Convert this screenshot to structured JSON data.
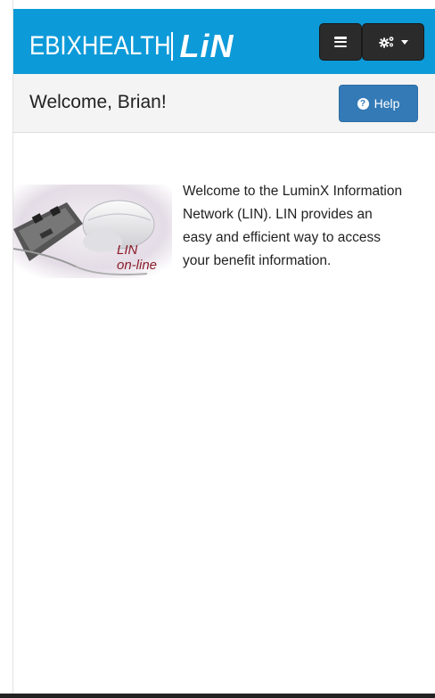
{
  "header": {
    "brand_ebix": "EBIXHEALTH",
    "brand_lin": "LiN",
    "menu_icon": "hamburger-icon",
    "settings_icon": "cogs-icon",
    "colors": {
      "topbar": "#0d9ad8",
      "dark_button": "#2b2b2b"
    }
  },
  "welcome": {
    "title": "Welcome, Brian!",
    "help_label": "Help",
    "help_icon": "question-circle-icon",
    "help_color": "#337ab7"
  },
  "main": {
    "image_caption_line1": "LIN",
    "image_caption_line2": "on-line",
    "intro_lines": [
      "Welcome to the LuminX Information",
      "Network (LIN). LIN provides an",
      "easy and efficient way to access",
      "your benefit information."
    ]
  }
}
